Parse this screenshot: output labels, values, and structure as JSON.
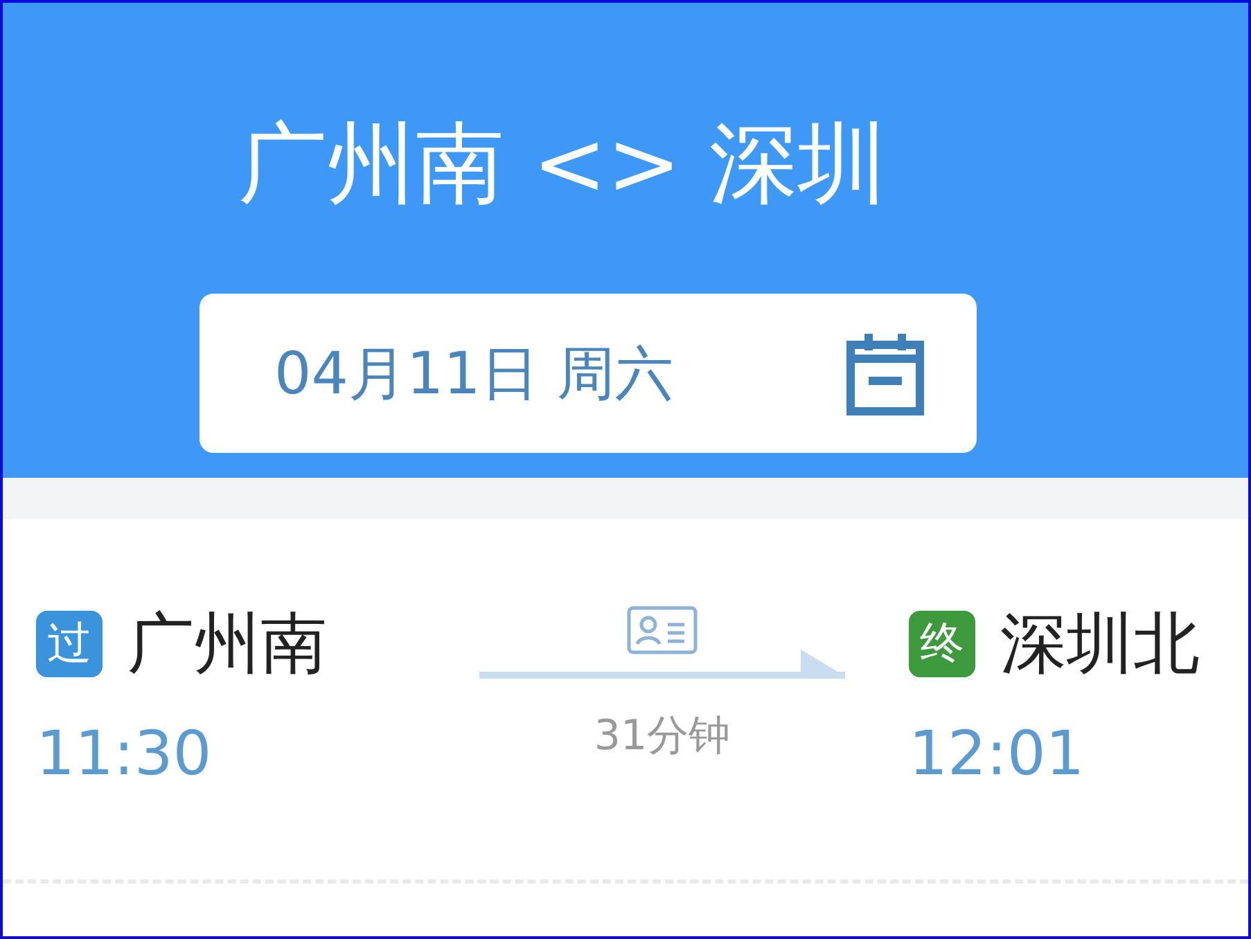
{
  "header": {
    "title": "广州南 <> 深圳",
    "date": "04月11日 周六"
  },
  "trip": {
    "stations": [
      {
        "badge": "过",
        "color": "#3b93dc",
        "station": "广州南",
        "time": "11:30"
      },
      {
        "badge": "终",
        "color": "#3c9a3c",
        "station": "深圳北",
        "time": "12:01"
      }
    ],
    "duration": "31分钟"
  }
}
